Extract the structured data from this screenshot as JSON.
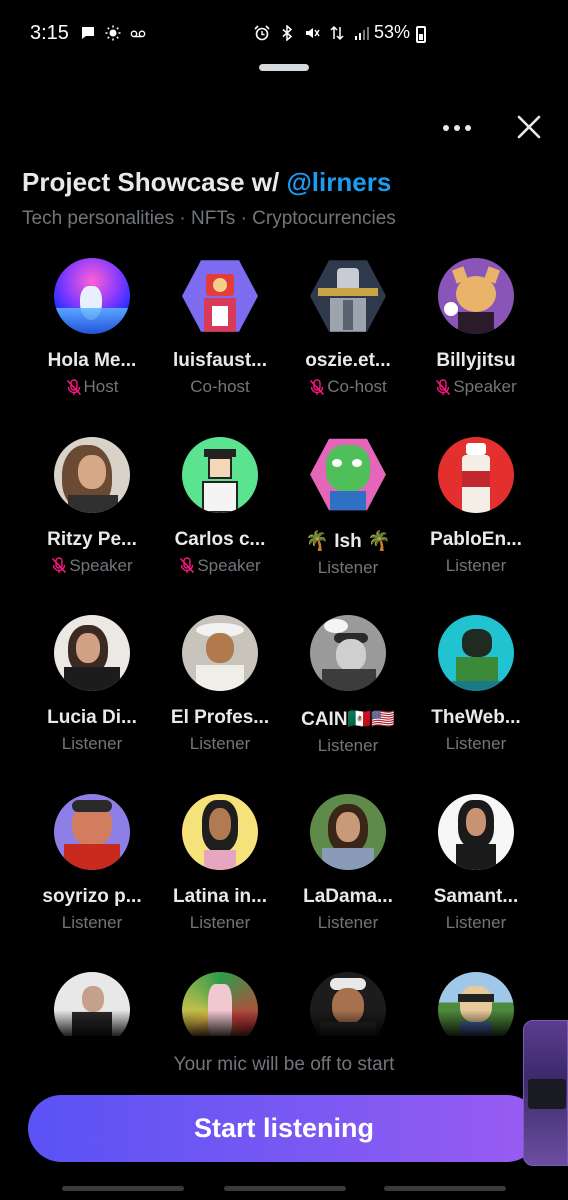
{
  "status_bar": {
    "time": "3:15",
    "battery": "53%",
    "icons": [
      "message-icon",
      "brightness-icon",
      "voicemail-icon",
      "alarm-icon",
      "bluetooth-icon",
      "mute-icon",
      "data-icon",
      "signal-icon",
      "battery-icon"
    ]
  },
  "space": {
    "title": "Project Showcase w/ ",
    "host_handle": "@lirners",
    "topics": "Tech personalities · NFTs · Cryptocurrencies"
  },
  "participants": [
    {
      "name": "Hola Me...",
      "role": "Host",
      "muted": true
    },
    {
      "name": "luisfaust...",
      "role": "Co-host",
      "muted": false
    },
    {
      "name": "oszie.et...",
      "role": "Co-host",
      "muted": true
    },
    {
      "name": "Billyjitsu",
      "role": "Speaker",
      "muted": true
    },
    {
      "name": "Ritzy Pe...",
      "role": "Speaker",
      "muted": true
    },
    {
      "name": "Carlos c...",
      "role": "Speaker",
      "muted": true
    },
    {
      "name": "🌴 Ish 🌴",
      "role": "Listener",
      "muted": false
    },
    {
      "name": "PabloEn...",
      "role": "Listener",
      "muted": false
    },
    {
      "name": "Lucia Di...",
      "role": "Listener",
      "muted": false
    },
    {
      "name": "El Profes...",
      "role": "Listener",
      "muted": false
    },
    {
      "name": "CAIN🇲🇽🇺🇸",
      "role": "Listener",
      "muted": false
    },
    {
      "name": "TheWeb...",
      "role": "Listener",
      "muted": false
    },
    {
      "name": "soyrizo p...",
      "role": "Listener",
      "muted": false
    },
    {
      "name": "Latina in...",
      "role": "Listener",
      "muted": false
    },
    {
      "name": "LaDama...",
      "role": "Listener",
      "muted": false
    },
    {
      "name": "Samant...",
      "role": "Listener",
      "muted": false
    },
    {
      "name": "",
      "role": "",
      "muted": false
    },
    {
      "name": "",
      "role": "",
      "muted": false
    },
    {
      "name": "",
      "role": "",
      "muted": false
    },
    {
      "name": "",
      "role": "",
      "muted": false
    }
  ],
  "footer": {
    "mic_note": "Your mic will be off to start",
    "start_label": "Start listening"
  },
  "colors": {
    "accent_link": "#1d9bf0",
    "muted_icon": "#f91880",
    "button_gradient_start": "#5a52f5",
    "button_gradient_end": "#9a5bf1"
  }
}
